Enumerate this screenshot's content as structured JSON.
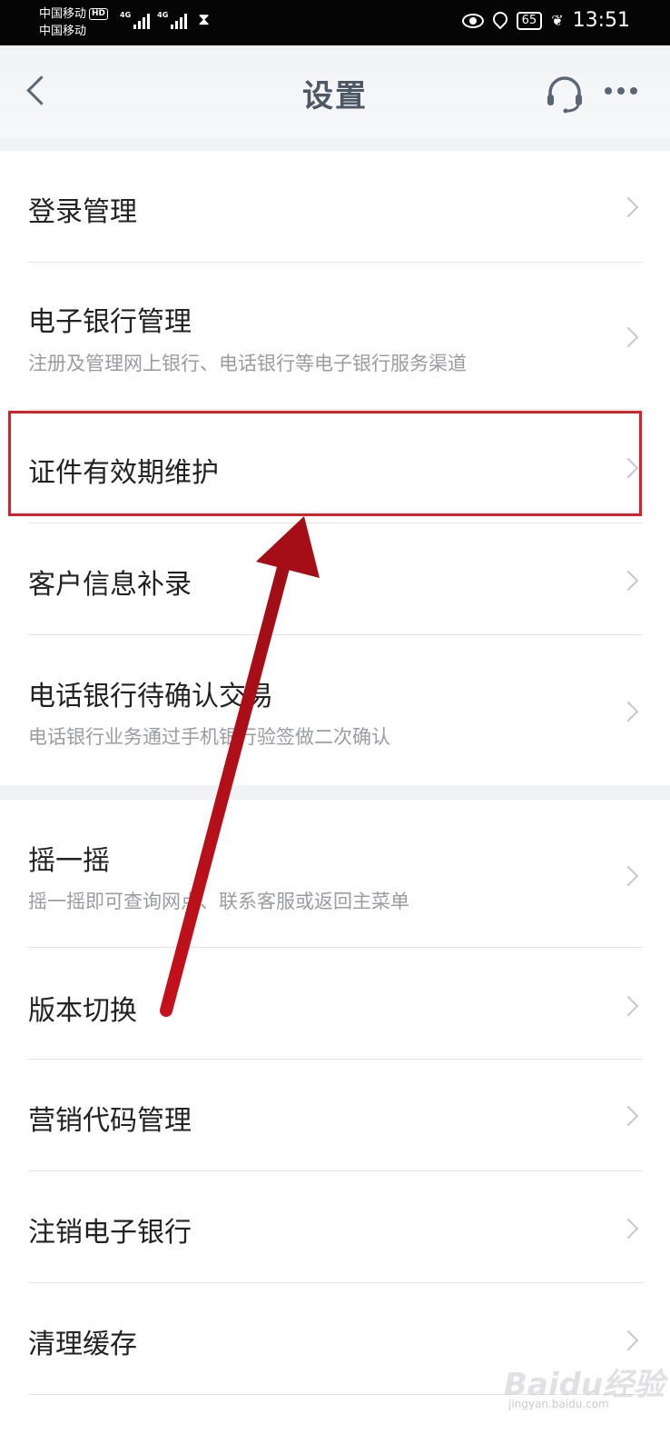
{
  "status_bar": {
    "carrier_1": "中国移动",
    "carrier_1_badge": "HD",
    "carrier_2": "中国移动",
    "signal_1_label": "4G",
    "signal_2_label": "4G",
    "battery": "65",
    "time": "13:51"
  },
  "header": {
    "title": "设置"
  },
  "menu": {
    "login": {
      "title": "登录管理"
    },
    "ebank": {
      "title": "电子银行管理",
      "subtitle": "注册及管理网上银行、电话银行等电子银行服务渠道"
    },
    "id_validity": {
      "title": "证件有效期维护"
    },
    "customer_info": {
      "title": "客户信息补录"
    },
    "phone_pending": {
      "title": "电话银行待确认交易",
      "subtitle": "电话银行业务通过手机银行验签做二次确认"
    },
    "shake": {
      "title": "摇一摇",
      "subtitle": "摇一摇即可查询网点、联系客服或返回主菜单"
    },
    "version": {
      "title": "版本切换"
    },
    "marketing": {
      "title": "营销代码管理"
    },
    "cancel_ebank": {
      "title": "注销电子银行"
    },
    "clear_cache": {
      "title": "清理缓存"
    }
  },
  "annotation": {
    "highlight_color": "#d81f2a",
    "arrow_color": "#b3121c"
  },
  "watermark": {
    "brand": "Baidu经验",
    "url": "jingyan.baidu.com"
  },
  "colors": {
    "statusbar": "#050505",
    "header_bg": "#f2f3f5",
    "title": "#4d5766",
    "subtitle": "#9a9ca0"
  }
}
